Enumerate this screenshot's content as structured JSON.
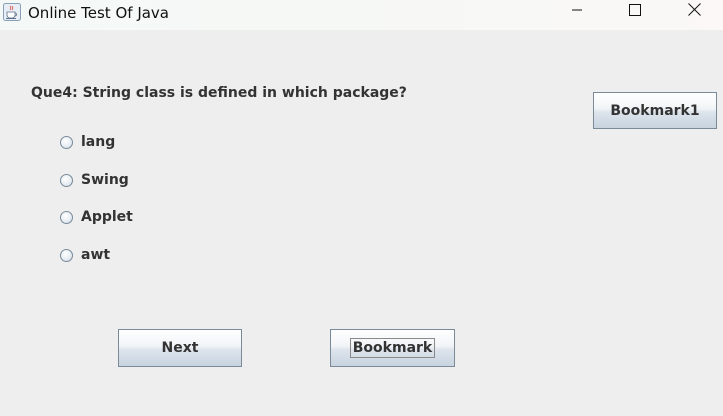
{
  "window": {
    "title": "Online Test Of Java",
    "app_icon": "java-cup-icon",
    "controls": {
      "minimize_icon": "minimize-icon",
      "maximize_icon": "maximize-icon",
      "close_icon": "close-icon"
    }
  },
  "quiz": {
    "question": "Que4: String class is defined in which package?",
    "options": [
      {
        "label": "lang",
        "selected": false
      },
      {
        "label": "Swing",
        "selected": false
      },
      {
        "label": "Applet",
        "selected": false
      },
      {
        "label": "awt",
        "selected": false
      }
    ]
  },
  "buttons": {
    "bookmark1_label": "Bookmark1",
    "next_label": "Next",
    "bookmark_label": "Bookmark"
  }
}
